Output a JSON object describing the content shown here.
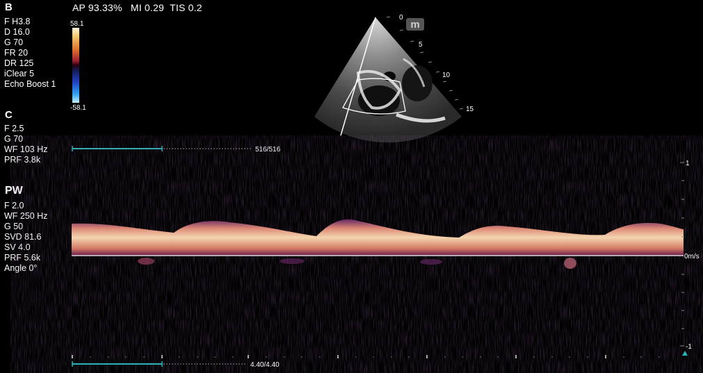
{
  "status": {
    "ap": "AP 93.33%",
    "mi": "MI 0.29",
    "tis": "TIS 0.2"
  },
  "b_mode": {
    "header": "B",
    "params": [
      "F H3.8",
      "D 16.0",
      "G 70",
      "FR 20",
      "DR 125",
      "iClear 5",
      "Echo Boost 1"
    ],
    "depth_labels": [
      "0",
      "5",
      "10",
      "15"
    ],
    "logo_letter": "m"
  },
  "color_scale": {
    "max": "58.1",
    "min": "-58.1"
  },
  "c_mode": {
    "header": "C",
    "params": [
      "F 2.5",
      "G 70",
      "WF 103 Hz",
      "PRF 3.8k"
    ]
  },
  "pw_mode": {
    "header": "PW",
    "params": [
      "F 2.0",
      "WF 250 Hz",
      "G 50",
      "SVD 81.6",
      "SV 4.0",
      "PRF 5.6k",
      "Angle   0°"
    ]
  },
  "cine_top": {
    "counter": "516/516"
  },
  "cine_bottom": {
    "counter": "4.40/4.40"
  },
  "doppler_scale": {
    "top_label": "1",
    "baseline_label": "0m/s",
    "bottom_label": "-1"
  },
  "colors": {
    "accent_teal": "#2bb3b8",
    "spectrum_hot": "#f6c493",
    "spectrum_mid": "#b04a6a",
    "spectrum_low": "#3a1a4a"
  }
}
